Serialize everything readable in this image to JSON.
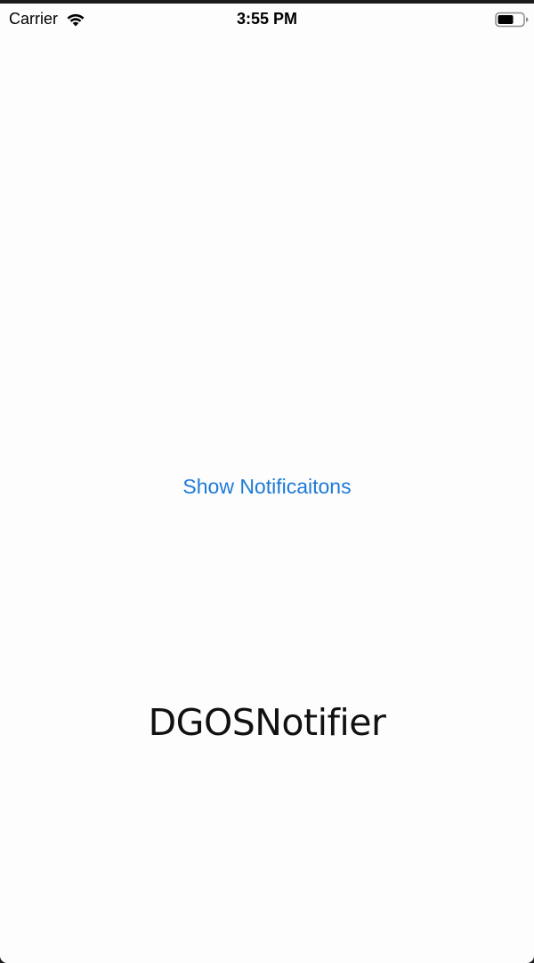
{
  "status_bar": {
    "carrier": "Carrier",
    "time": "3:55 PM",
    "icons": {
      "wifi": "wifi-icon",
      "battery": "battery-icon"
    }
  },
  "main": {
    "show_button_label": "Show Notificaitons",
    "title": "DGOSNotifier"
  },
  "colors": {
    "background": "#fefdfe",
    "accent": "#1c7ad6",
    "text": "#000000"
  }
}
